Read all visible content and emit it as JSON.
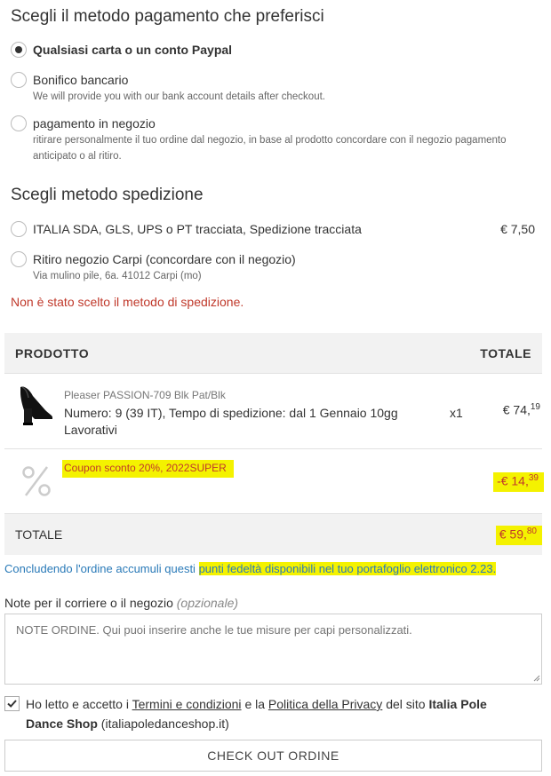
{
  "payment": {
    "title": "Scegli il metodo pagamento che preferisci",
    "options": [
      {
        "label": "Qualsiasi carta o un conto Paypal",
        "desc": "",
        "selected": true
      },
      {
        "label": "Bonifico bancario",
        "desc": "We will provide you with our bank account details after checkout.",
        "selected": false
      },
      {
        "label": "pagamento in negozio",
        "desc": "ritirare personalmente il tuo ordine dal negozio, in base al prodotto concordare con il negozio pagamento anticipato o al ritiro.",
        "selected": false
      }
    ]
  },
  "shipping": {
    "title": "Scegli metodo spedizione",
    "options": [
      {
        "label": "ITALIA SDA, GLS, UPS o PT tracciata, Spedizione tracciata",
        "price": "€ 7,50",
        "desc": "",
        "selected": false
      },
      {
        "label": "Ritiro negozio Carpi (concordare con il negozio)",
        "price": "",
        "desc": "Via mulino pile, 6a. 41012 Carpi (mo)",
        "selected": false
      }
    ],
    "error": "Non è stato scelto il metodo di spedizione."
  },
  "table": {
    "col_product": "PRODOTTO",
    "col_total": "TOTALE",
    "product": {
      "name": "Pleaser PASSION-709 Blk Pat/Blk",
      "details": "Numero: 9 (39 IT), Tempo di spedizione: dal 1 Gennaio 10gg Lavorativi",
      "qty": "x1",
      "price_main": "€ 74,",
      "price_cents": "19"
    },
    "coupon": {
      "label": "Coupon sconto 20%, 2022SUPER",
      "icon": "percent-icon",
      "price_main": "-€ 14,",
      "price_cents": "39"
    },
    "total": {
      "label": "TOTALE",
      "price_main": "€ 59,",
      "price_cents": "80"
    }
  },
  "loyalty": {
    "prefix": "Concludendo l'ordine accumuli questi",
    "highlight": "punti fedeltà disponibili nel tuo portafoglio elettronico 2.23."
  },
  "notes": {
    "label": "Note per il corriere o il negozio",
    "optional": "(opzionale)",
    "placeholder": "NOTE ORDINE. Qui puoi inserire anche le tue misure per capi personalizzati."
  },
  "terms": {
    "checked": true,
    "text1": "Ho letto e accetto i",
    "link1": "Termini e condizioni",
    "text2": "e la",
    "link2": "Politica della Privacy",
    "text3": "del sito",
    "site_name": "Italia Pole Dance Shop",
    "site_domain": "(italiapoledanceshop.it)"
  },
  "checkout_button": "CHECK OUT ORDINE",
  "colors": {
    "highlight": "#f4f200",
    "error": "#c0392b",
    "link_blue": "#2a7ab8"
  }
}
